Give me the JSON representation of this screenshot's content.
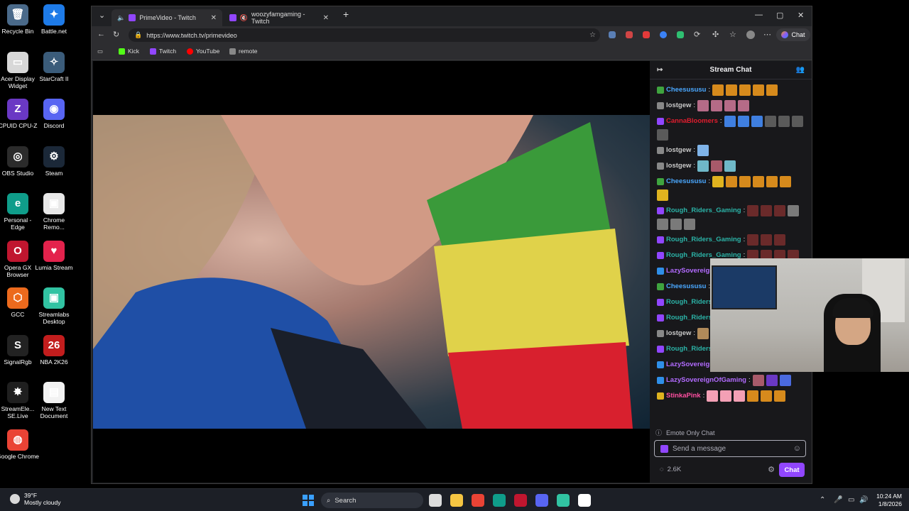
{
  "desktop": {
    "icons": [
      {
        "label": "Recycle Bin",
        "glyph": "🗑",
        "color": "#4a6a8a"
      },
      {
        "label": "Battle.net",
        "glyph": "✦",
        "color": "#1e7be8"
      },
      {
        "label": "Acer Display Widget",
        "glyph": "▭",
        "color": "#d8d8d8"
      },
      {
        "label": "StarCraft II",
        "glyph": "✧",
        "color": "#3b5c7a"
      },
      {
        "label": "CPUID CPU-Z",
        "glyph": "Z",
        "color": "#6a38c4"
      },
      {
        "label": "Discord",
        "glyph": "◉",
        "color": "#5865f2"
      },
      {
        "label": "OBS Studio",
        "glyph": "◎",
        "color": "#2b2b2b"
      },
      {
        "label": "Steam",
        "glyph": "⚙",
        "color": "#1b2838"
      },
      {
        "label": "Personal - Edge",
        "glyph": "e",
        "color": "#0f9d8a"
      },
      {
        "label": "Chrome Remo...",
        "glyph": "▣",
        "color": "#e8e8e8"
      },
      {
        "label": "Opera GX Browser",
        "glyph": "O",
        "color": "#c0162f"
      },
      {
        "label": "Lumia Stream",
        "glyph": "♥",
        "color": "#e3224c"
      },
      {
        "label": "GCC",
        "glyph": "⬡",
        "color": "#ec6a1d"
      },
      {
        "label": "Streamlabs Desktop",
        "glyph": "▣",
        "color": "#31c3a2"
      },
      {
        "label": "SignalRgb",
        "glyph": "S",
        "color": "#222"
      },
      {
        "label": "NBA 2K26",
        "glyph": "26",
        "color": "#c21d1d"
      },
      {
        "label": "StreamEle... SE.Live",
        "glyph": "✸",
        "color": "#1f1f1f"
      },
      {
        "label": "New Text Document",
        "glyph": "▤",
        "color": "#f2f2f2"
      },
      {
        "label": "Google Chrome",
        "glyph": "◍",
        "color": "#ea4335"
      }
    ]
  },
  "browser": {
    "tabs": [
      {
        "title": "PrimeVideo - Twitch",
        "active": true
      },
      {
        "title": "woozyfamgaming - Twitch",
        "active": false
      }
    ],
    "new_tab": "+",
    "url": "https://www.twitch.tv/primevideo",
    "copilot_label": "Chat",
    "bookmarks": [
      {
        "label": "Kick",
        "color": "#53fc18"
      },
      {
        "label": "Twitch",
        "color": "#9146ff"
      },
      {
        "label": "YouTube",
        "color": "#ff0000"
      },
      {
        "label": "remote",
        "color": "#888888"
      }
    ]
  },
  "chat": {
    "title": "Stream Chat",
    "messages": [
      {
        "user": "Cheesususu",
        "color": "#4aa8ff",
        "badge": "#3fa43f",
        "emotes": [
          "#d68a1c",
          "#d68a1c",
          "#d68a1c",
          "#d68a1c",
          "#d68a1c"
        ]
      },
      {
        "user": "lostgew",
        "color": "#c9c9c9",
        "badge": "#888",
        "emotes": [
          "#b56b87",
          "#b56b87",
          "#b56b87",
          "#b56b87"
        ]
      },
      {
        "user": "CannaBloomers",
        "color": "#e11d2e",
        "badge": "#9146ff",
        "emotes": [
          "#3f7fe0",
          "#3f7fe0",
          "#3f7fe0",
          "#5a5a5a",
          "#5a5a5a",
          "#5a5a5a",
          "#5a5a5a"
        ]
      },
      {
        "user": "lostgew",
        "color": "#c9c9c9",
        "badge": "#888",
        "emotes": [
          "#7fb3e8"
        ]
      },
      {
        "user": "lostgew",
        "color": "#c9c9c9",
        "badge": "#888",
        "emotes": [
          "#6fb8c8",
          "#a85a6a",
          "#6fb8c8"
        ]
      },
      {
        "user": "Cheesususu",
        "color": "#4aa8ff",
        "badge": "#3fa43f",
        "emotes": [
          "#e0b31f",
          "#d68a1c",
          "#d68a1c",
          "#d68a1c",
          "#d68a1c",
          "#d68a1c",
          "#e0b31f"
        ]
      },
      {
        "user": "Rough_Riders_Gaming",
        "color": "#2bb3a7",
        "badge": "#9146ff",
        "emotes": [
          "#6a2a2a",
          "#6a2a2a",
          "#6a2a2a",
          "#7a7a7a",
          "#7a7a7a",
          "#7a7a7a",
          "#7a7a7a"
        ]
      },
      {
        "user": "Rough_Riders_Gaming",
        "color": "#2bb3a7",
        "badge": "#9146ff",
        "emotes": [
          "#6a2a2a",
          "#6a2a2a",
          "#6a2a2a"
        ]
      },
      {
        "user": "Rough_Riders_Gaming",
        "color": "#2bb3a7",
        "badge": "#9146ff",
        "emotes": [
          "#6a2a2a",
          "#6a2a2a",
          "#6a2a2a",
          "#6a2a2a"
        ]
      },
      {
        "user": "LazySovereignOfGaming",
        "color": "#b26bff",
        "badge": "#2f8fe8",
        "emotes": [
          "#e0b31f",
          "#e11d2e"
        ]
      },
      {
        "user": "Cheesususu",
        "color": "#4aa8ff",
        "badge": "#3fa43f",
        "emotes": [
          "#e0b31f"
        ]
      },
      {
        "user": "Rough_Riders_Gaming",
        "color": "#2bb3a7",
        "badge": "#9146ff",
        "emotes": [
          "#7a7a7a",
          "#7a7a7a"
        ]
      },
      {
        "user": "Rough_Riders_Gaming",
        "color": "#2bb3a7",
        "badge": "#9146ff",
        "emotes": [
          "#6a2a2a"
        ]
      },
      {
        "user": "lostgew",
        "color": "#c9c9c9",
        "badge": "#888",
        "emotes": [
          "#b08a5a"
        ]
      },
      {
        "user": "Rough_Riders_Gaming",
        "color": "#2bb3a7",
        "badge": "#9146ff",
        "emotes": [
          "#6a2a2a",
          "#6a2a2a",
          "#6a2a2a",
          "#6a2a2a"
        ]
      },
      {
        "user": "LazySovereignOfGaming",
        "color": "#b26bff",
        "badge": "#2f8fe8",
        "emotes": [
          "#6fb8c8",
          "#7fb3e8",
          "#6fb8c8"
        ]
      },
      {
        "user": "LazySovereignOfGaming",
        "color": "#b26bff",
        "badge": "#2f8fe8",
        "emotes": [
          "#a85a6a",
          "#6a38c4",
          "#4a6adf"
        ]
      },
      {
        "user": "StinkaPink",
        "color": "#ff4fa1",
        "badge": "#e0b31f",
        "emotes": [
          "#f3a0b5",
          "#f3a0b5",
          "#f3a0b5",
          "#d68a1c",
          "#d68a1c",
          "#d68a1c"
        ]
      }
    ],
    "emote_only": "Emote Only Chat",
    "input_placeholder": "Send a message",
    "points": "2.6K",
    "send_label": "Chat"
  },
  "taskbar": {
    "weather_temp": "39°F",
    "weather_desc": "Mostly cloudy",
    "search_label": "Search",
    "time": "10:24 AM",
    "date": "1/8/2026",
    "apps": [
      {
        "name": "task-view",
        "color": "#dcdcdc"
      },
      {
        "name": "file-explorer",
        "color": "#f5c542"
      },
      {
        "name": "chrome",
        "color": "#ea4335"
      },
      {
        "name": "edge",
        "color": "#0f9d8a"
      },
      {
        "name": "opera-gx",
        "color": "#c0162f"
      },
      {
        "name": "discord",
        "color": "#5865f2"
      },
      {
        "name": "streamlabs",
        "color": "#31c3a2"
      },
      {
        "name": "obs",
        "color": "#ffffff"
      }
    ]
  }
}
